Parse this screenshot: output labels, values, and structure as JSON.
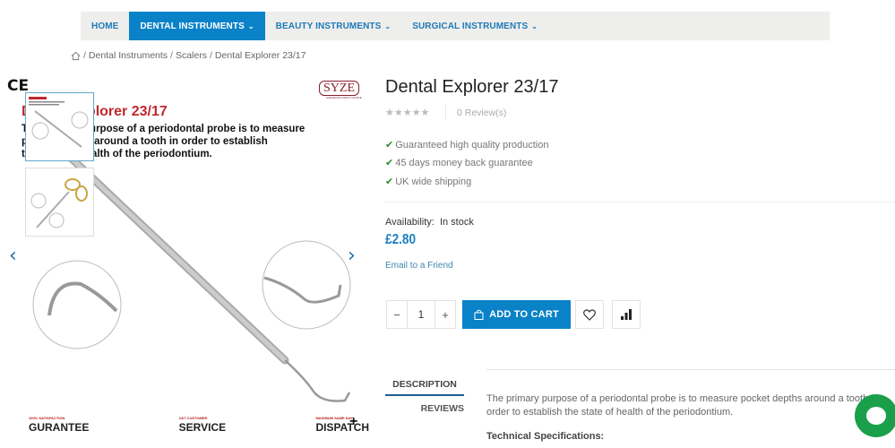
{
  "header": {
    "tagline": "SURGEON'S FIRST CHOICE"
  },
  "nav": [
    {
      "label": "HOME",
      "active": false,
      "dropdown": false
    },
    {
      "label": "DENTAL INSTRUMENTS",
      "active": true,
      "dropdown": true
    },
    {
      "label": "BEAUTY INSTRUMENTS",
      "active": false,
      "dropdown": true
    },
    {
      "label": "SURGICAL INSTRUMENTS",
      "active": false,
      "dropdown": true
    }
  ],
  "breadcrumb": {
    "icon": "home-icon",
    "items": [
      "Dental Instruments",
      "Scalers",
      "Dental Explorer 23/17"
    ],
    "separator": "/"
  },
  "gallery": {
    "ce_mark": "CE",
    "brand": "SYZE",
    "brand_sub": "SURGEON'S FIRST CHOICE",
    "image_title": "Dental Explorer 23/17",
    "image_text": [
      "The primary purpose of a periodontal probe is to measure",
      "pocket depths around a tooth in order to establish",
      "the state of health of the periodontium."
    ],
    "prev_icon": "chevron-left-icon",
    "next_icon": "chevron-right-icon",
    "badges": [
      {
        "small": "100% SATISFACTION",
        "big": "GURANTEE"
      },
      {
        "small": "24/7 CUSTOMER",
        "big": "SERVICE"
      },
      {
        "small": "MAXIMUM SAME DAY",
        "big": "DISPATCH"
      }
    ],
    "zoom_label": "+"
  },
  "product": {
    "title": "Dental Explorer 23/17",
    "rating": 0,
    "rating_max": 5,
    "reviews": "0 Review(s)",
    "features": [
      "Guaranteed high quality production",
      "45 days money back guarantee",
      "UK wide shipping"
    ],
    "availability_label": "Availability:",
    "availability_value": "In stock",
    "price": "£2.80",
    "email_link": "Email to a Friend",
    "quantity": "1",
    "minus": "−",
    "plus": "+",
    "add_to_cart": "ADD TO CART"
  },
  "tabs": [
    {
      "label": "DESCRIPTION",
      "active": true
    },
    {
      "label": "REVIEWS",
      "active": false
    }
  ],
  "description": {
    "text": "The primary purpose of a periodontal probe is to measure pocket depths around a tooth in order to establish the state of health of the periodontium.",
    "spec_heading": "Technical Specifications:"
  },
  "colors": {
    "accent": "#0a82c8",
    "price": "#1b7fc0",
    "chat": "#1a9f4a",
    "check": "#2e8b2e"
  }
}
